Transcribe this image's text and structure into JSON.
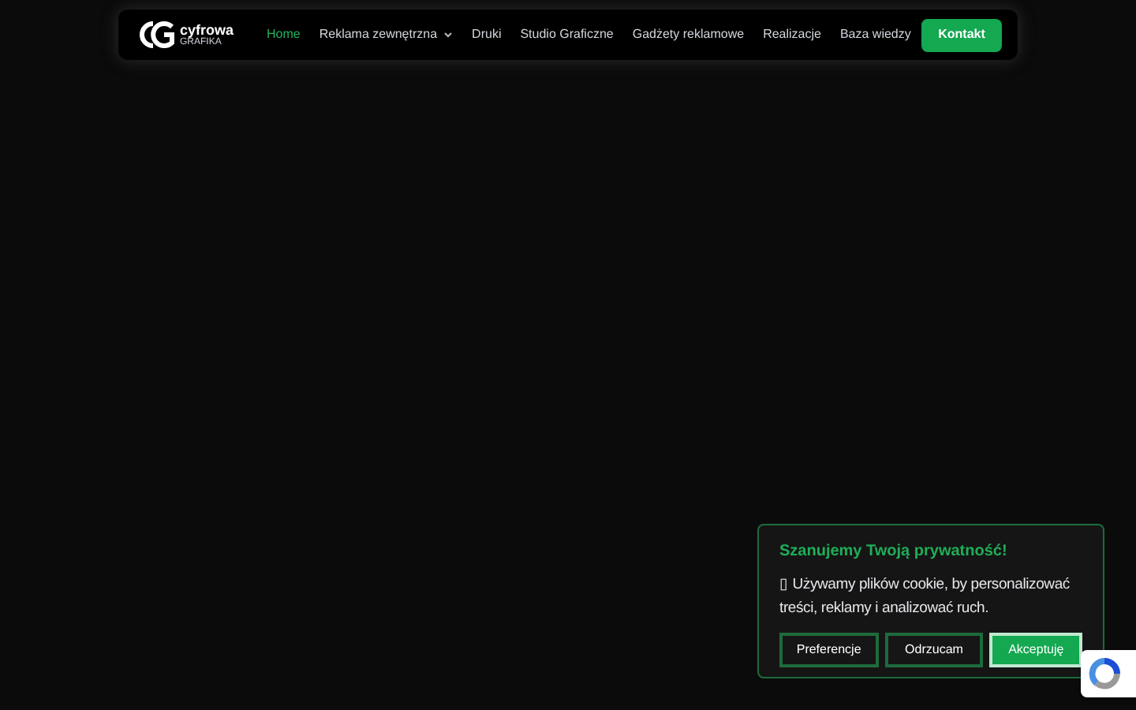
{
  "logo": {
    "line_1": "cyfrowa",
    "line_2": "GRAFIKA"
  },
  "nav": [
    {
      "label": "Home",
      "selected": true,
      "dropdown": false
    },
    {
      "label": "Reklama zewnętrzna",
      "selected": false,
      "dropdown": true
    },
    {
      "label": "Druki",
      "selected": false,
      "dropdown": false
    },
    {
      "label": "Studio Graficzne",
      "selected": false,
      "dropdown": false
    },
    {
      "label": "Gadżety reklamowe",
      "selected": false,
      "dropdown": false
    },
    {
      "label": "Realizacje",
      "selected": false,
      "dropdown": false
    },
    {
      "label": "Baza wiedzy",
      "selected": false,
      "dropdown": false
    }
  ],
  "contact_button": "Kontakt",
  "cookie_banner": {
    "title": "Szanujemy Twoją prywatność!",
    "text": "▯ Używamy plików cookie, by personalizować treści, reklamy i analizować ruch.",
    "buttons": [
      {
        "label": "Preferencje",
        "kind": "outline"
      },
      {
        "label": "Odrzucam",
        "kind": "outline"
      },
      {
        "label": "Akceptuję",
        "kind": "filled"
      }
    ]
  }
}
